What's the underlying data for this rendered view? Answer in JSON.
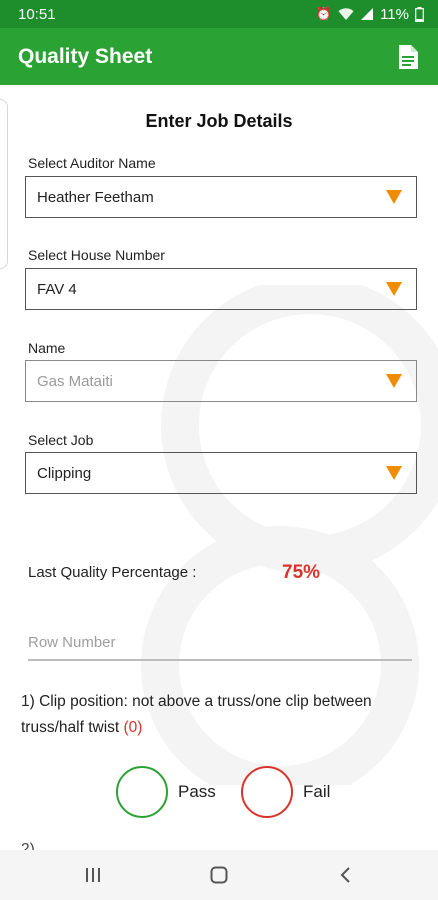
{
  "status_bar": {
    "time": "10:51",
    "battery": "11%"
  },
  "app_bar": {
    "title": "Quality Sheet",
    "action_icon": "document-icon"
  },
  "form": {
    "heading": "Enter Job Details",
    "auditor": {
      "label": "Select Auditor Name",
      "value": "Heather Feetham"
    },
    "house": {
      "label": "Select House Number",
      "value": "FAV 4"
    },
    "name": {
      "label": "Name",
      "value": "Gas Mataiti"
    },
    "job": {
      "label": "Select Job",
      "value": "Clipping"
    }
  },
  "quality": {
    "label": "Last Quality Percentage :",
    "value": "75%"
  },
  "row_number": {
    "placeholder": "Row Number",
    "value": ""
  },
  "question1": {
    "text": "1) Clip position: not above a truss/one clip between truss/half twist",
    "score": "(0)",
    "pass_label": "Pass",
    "fail_label": "Fail"
  },
  "question2": {
    "text_partial": "2) ..."
  },
  "colors": {
    "primary": "#2ba334",
    "primary_dark": "#1e8e2c",
    "accent": "#f08c00",
    "error": "#d9342b"
  }
}
